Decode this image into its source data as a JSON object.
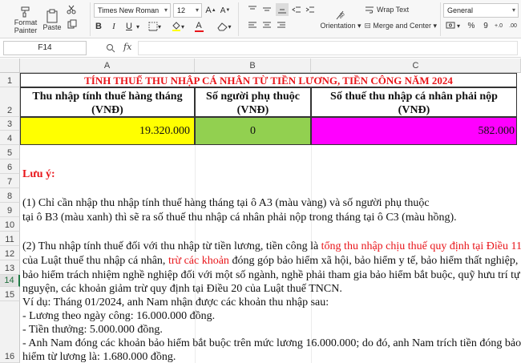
{
  "ribbon": {
    "format_painter": [
      "Format",
      "Painter"
    ],
    "paste": "Paste",
    "font_name": "Times New Roman",
    "font_size": "12",
    "bold": "B",
    "italic": "I",
    "underline": "U",
    "font_grow": "A",
    "font_shrink": "A",
    "font_color_letter": "A",
    "orientation": "Orientation",
    "wrap_text": "Wrap Text",
    "merge_center": "Merge and Center",
    "number_format": "General",
    "percent": "%",
    "comma": "9",
    "dec_inc": "+.0",
    "dec_dec": ".00",
    "accent_red": "#e8151a"
  },
  "formula_bar": {
    "name_box": "F14",
    "fx_label": "fx",
    "formula": ""
  },
  "columns": [
    "A",
    "B",
    "C"
  ],
  "rows": [
    "1",
    "2",
    "3",
    "4",
    "5",
    "6",
    "7",
    "8",
    "9",
    "10",
    "11",
    "12",
    "13",
    "14",
    "15",
    "16"
  ],
  "sheet": {
    "title": "TÍNH THUẾ THU NHẬP CÁ NHÂN TỪ TIỀN LƯƠNG, TIỀN CÔNG NĂM 2024",
    "headers": [
      [
        "Thu nhập tính thuế hàng tháng",
        "(VNĐ)"
      ],
      [
        "Số người phụ thuộc",
        "(VNĐ)"
      ],
      [
        "Số thuế thu nhập cá nhân phải nộp",
        "(VNĐ)"
      ]
    ],
    "values": {
      "a3": "19.320.000",
      "b3": "0",
      "c3": "582.000"
    },
    "colors": {
      "a3": "#ffff00",
      "b3": "#92d050",
      "c3": "#ff00ff"
    }
  },
  "notes": {
    "heading": "Lưu ý:",
    "p1_line1": "(1) Chỉ cần nhập thu nhập tính thuế hàng tháng tại ô A3 (màu vàng) và số người phụ thuộc",
    "p1_line2": "tại ô B3 (màu xanh) thì sẽ ra số thuế thu nhập cá nhân phải nộp trong tháng tại ô C3 (màu hồng).",
    "p2_line1_a": "(2) Thu nhập tính thuế đối với thu nhập từ tiền lương, tiền công là ",
    "p2_line1_red": "tổng thu nhập chịu thuế quy định tại Điều 11",
    "p2_line2_a": "của Luật thuế thu nhập cá nhân, ",
    "p2_line2_red": "trừ các khoản",
    "p2_line2_b": " đóng góp bảo hiểm xã hội, bảo hiểm y tế, bảo hiểm thất nghiệp,",
    "p2_line3": "bảo hiểm trách nhiệm nghề nghiệp đối với một số ngành, nghề phải tham gia bảo hiểm bắt buộc, quỹ hưu trí tự",
    "p2_line4": "nguyện, các khoản giảm trừ quy định tại Điều 20 của Luật thuế TNCN.",
    "ex_line1": "Ví dụ: Tháng 01/2024, anh Nam nhận được các khoản thu nhập sau:",
    "ex_line2": "- Lương theo ngày công: 16.000.000 đồng.",
    "ex_line3": "- Tiền thưởng: 5.000.000 đồng.",
    "ex_line4": "- Anh Nam đóng các khoản bảo hiểm bắt buộc trên mức lương 16.000.000; do đó, anh Nam trích tiền đóng bảo",
    "ex_line5": "hiểm từ lương là: 1.680.000 đồng."
  }
}
